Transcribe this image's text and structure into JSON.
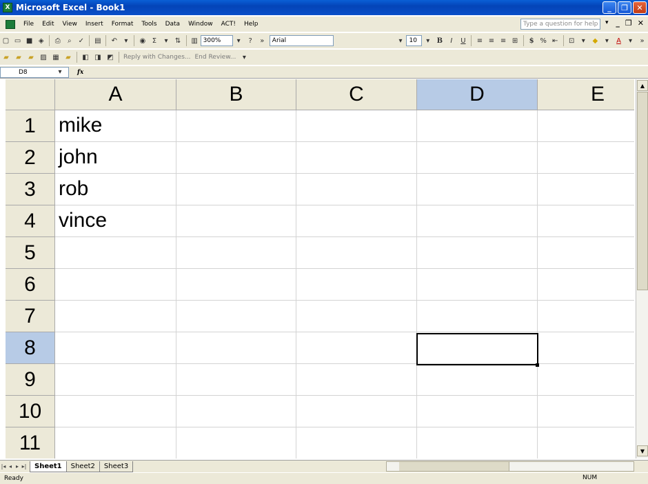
{
  "window": {
    "title": "Microsoft Excel - Book1",
    "minimize": "_",
    "restore": "❐",
    "close": "✕"
  },
  "menu": {
    "items": [
      "File",
      "Edit",
      "View",
      "Insert",
      "Format",
      "Tools",
      "Data",
      "Window",
      "ACT!",
      "Help"
    ],
    "help_placeholder": "Type a question for help",
    "help_dropdown": "▾",
    "doc_minimize": "_",
    "doc_restore": "❐",
    "doc_close": "✕"
  },
  "toolbar": {
    "zoom": "300%",
    "font_name": "Arial",
    "font_size": "10",
    "bold_label": "B",
    "italic_label": "I",
    "underline_label": "U",
    "currency_label": "$",
    "percent_label": "%",
    "font_color_label": "A",
    "reply_with_changes": "Reply with Changes...",
    "end_review": "End Review..."
  },
  "formula_bar": {
    "name_box": "D8",
    "fx_label": "fx",
    "content": ""
  },
  "grid": {
    "columns": [
      "A",
      "B",
      "C",
      "D",
      "E"
    ],
    "rows": [
      "1",
      "2",
      "3",
      "4",
      "5",
      "6",
      "7",
      "8",
      "9",
      "10",
      "11"
    ],
    "column_a_values": [
      "mike",
      "john",
      "rob",
      "vince",
      "",
      "",
      "",
      "",
      "",
      "",
      ""
    ],
    "active_cell": "D8",
    "active_column": "D",
    "active_row": "8"
  },
  "sheets": {
    "tabs": [
      "Sheet1",
      "Sheet2",
      "Sheet3"
    ],
    "active": "Sheet1"
  },
  "status": {
    "text": "Ready",
    "num_lock": "NUM"
  }
}
